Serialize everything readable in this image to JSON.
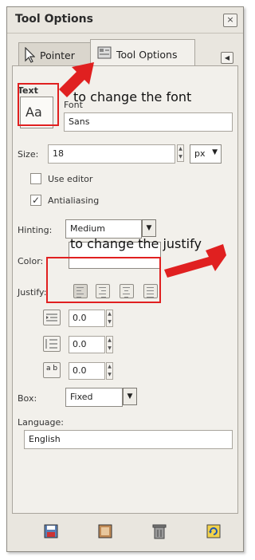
{
  "window": {
    "title": "Tool Options",
    "close_glyph": "×"
  },
  "tabs": [
    {
      "label": "Pointer",
      "icon": "pointer-arrow-icon"
    },
    {
      "label": "Tool Options",
      "icon": "tool-options-icon"
    }
  ],
  "text_section": {
    "label": "Text",
    "font_label": "Font",
    "font_value": "Sans",
    "font_button": "Aa"
  },
  "size": {
    "label": "Size:",
    "value": "18",
    "unit": "px"
  },
  "use_editor": {
    "label": "Use editor",
    "checked": false
  },
  "antialiasing": {
    "label": "Antialiasing",
    "checked": true
  },
  "hinting": {
    "label": "Hinting:",
    "value": "Medium"
  },
  "color": {
    "label": "Color:"
  },
  "justify": {
    "label": "Justify:"
  },
  "indent": {
    "value": "0.0"
  },
  "line_spacing": {
    "value": "0.0"
  },
  "letter_spacing": {
    "value": "0.0",
    "icon_label": "a b"
  },
  "box": {
    "label": "Box:",
    "value": "Fixed"
  },
  "language": {
    "label": "Language:",
    "value": "English"
  },
  "annotations": {
    "font_note": "to change the font",
    "justify_note": "to change the justify"
  },
  "colors": {
    "accent_red": "#e02020",
    "window_bg": "#e9e6df"
  }
}
